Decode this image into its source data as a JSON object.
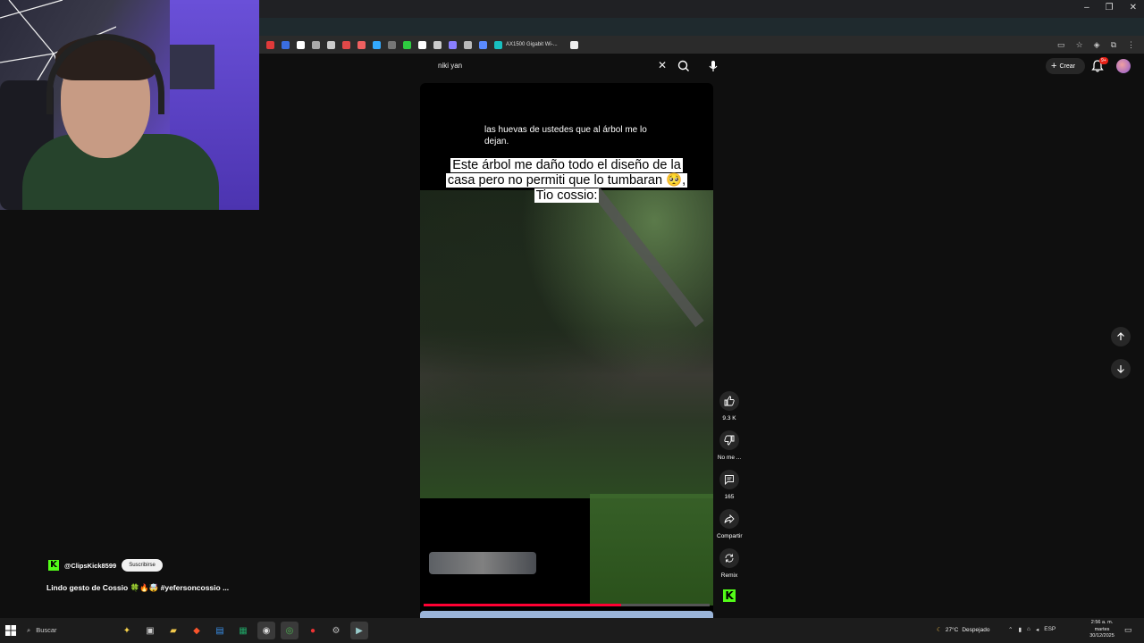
{
  "browser": {
    "bookmark_label": "AX1500 Gigabit Wi-..."
  },
  "webcam": {
    "icon": "webcam-overlay"
  },
  "youtube": {
    "search": {
      "query": "niki yan"
    },
    "create_label": "Crear",
    "notif_badge": "9+"
  },
  "short": {
    "top_caption": "las huevas de ustedes que al árbol me lo dejan.",
    "big_caption": "Este árbol me daño todo el diseño de la casa pero no permiti que lo tumbaran 🥺, Tio cossio:",
    "progress_fraction": 0.69,
    "actions": [
      {
        "name": "like",
        "label": "9.3 K"
      },
      {
        "name": "dislike",
        "label": "No me ..."
      },
      {
        "name": "comments",
        "label": "165"
      },
      {
        "name": "share",
        "label": "Compartir"
      },
      {
        "name": "remix",
        "label": "Remix"
      }
    ],
    "channel": {
      "name": "@ClipsKick8599",
      "subscribe_label": "Suscribirse"
    },
    "title": "Lindo gesto de Cossio 🍀🔥🤯 #yefersoncossio ..."
  },
  "taskbar": {
    "search_label": "Buscar",
    "weather": "27°C",
    "weather_desc": "Despejado",
    "lang": "ESP",
    "time": "2:56 a. m.",
    "day": "martes",
    "date": "30/12/2025"
  },
  "colors": {
    "kick_green": "#53fc18",
    "yt_red": "#ff0033",
    "yt_bg": "#0f0f0f"
  }
}
